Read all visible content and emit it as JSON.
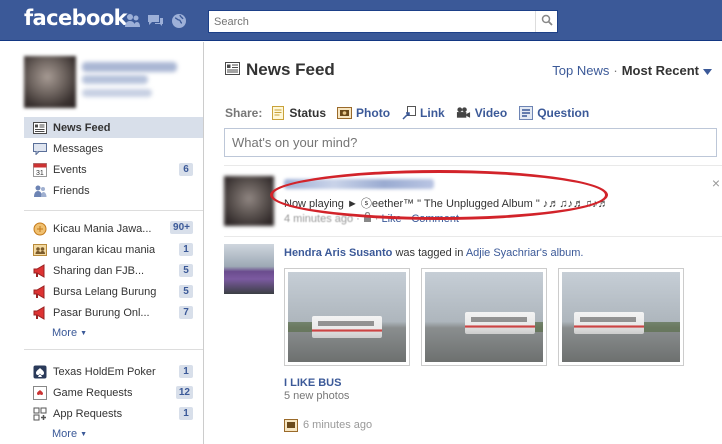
{
  "topbar": {
    "logo": "facebook",
    "search_placeholder": "Search"
  },
  "left": {
    "nav": [
      {
        "label": "News Feed",
        "icon": "news-feed-icon",
        "count": ""
      },
      {
        "label": "Messages",
        "icon": "messages-icon",
        "count": ""
      },
      {
        "label": "Events",
        "icon": "calendar-icon",
        "count": "6"
      },
      {
        "label": "Friends",
        "icon": "friends-icon",
        "count": ""
      }
    ],
    "groups": [
      {
        "label": "Kicau Mania Jawa...",
        "icon": "page-icon",
        "count": ""
      },
      {
        "label": "ungaran kicau mania",
        "icon": "group-icon",
        "count": "1"
      },
      {
        "label": "Sharing dan FJB...",
        "icon": "megaphone-icon",
        "count": "5"
      },
      {
        "label": "Bursa Lelang Burung",
        "icon": "megaphone-icon",
        "count": "5"
      },
      {
        "label": "Pasar Burung Onl...",
        "icon": "megaphone-icon",
        "count": "7"
      }
    ],
    "groups_more": "More",
    "groups_more_count": "90+",
    "apps": [
      {
        "label": "Texas HoldEm Poker",
        "icon": "poker-icon",
        "count": "1"
      },
      {
        "label": "Game Requests",
        "icon": "game-icon",
        "count": "12"
      },
      {
        "label": "App Requests",
        "icon": "apps-icon",
        "count": "1"
      }
    ],
    "apps_more": "More"
  },
  "main": {
    "title": "News Feed",
    "sort_top": "Top News",
    "sort_dot": "·",
    "sort_current": "Most Recent",
    "share_label": "Share:",
    "share_items": [
      "Status",
      "Photo",
      "Link",
      "Video",
      "Question"
    ],
    "composer_placeholder": "What's on your mind?",
    "story1": {
      "message": "Now playing ► ⓢeether™ \" The Unplugged Album \" ♪♬♫♪♬♫♪♬",
      "time": "4 minutes ago",
      "like": "Like",
      "comment": "Comment",
      "close": "×"
    },
    "story2": {
      "actor": "Hendra Aris Susanto",
      "verb": "was tagged in",
      "owner": "Adjie Syachriar's",
      "album_word": "album.",
      "album_title": "I LIKE BUS",
      "album_sub": "5 new photos",
      "time": "6 minutes ago"
    }
  }
}
